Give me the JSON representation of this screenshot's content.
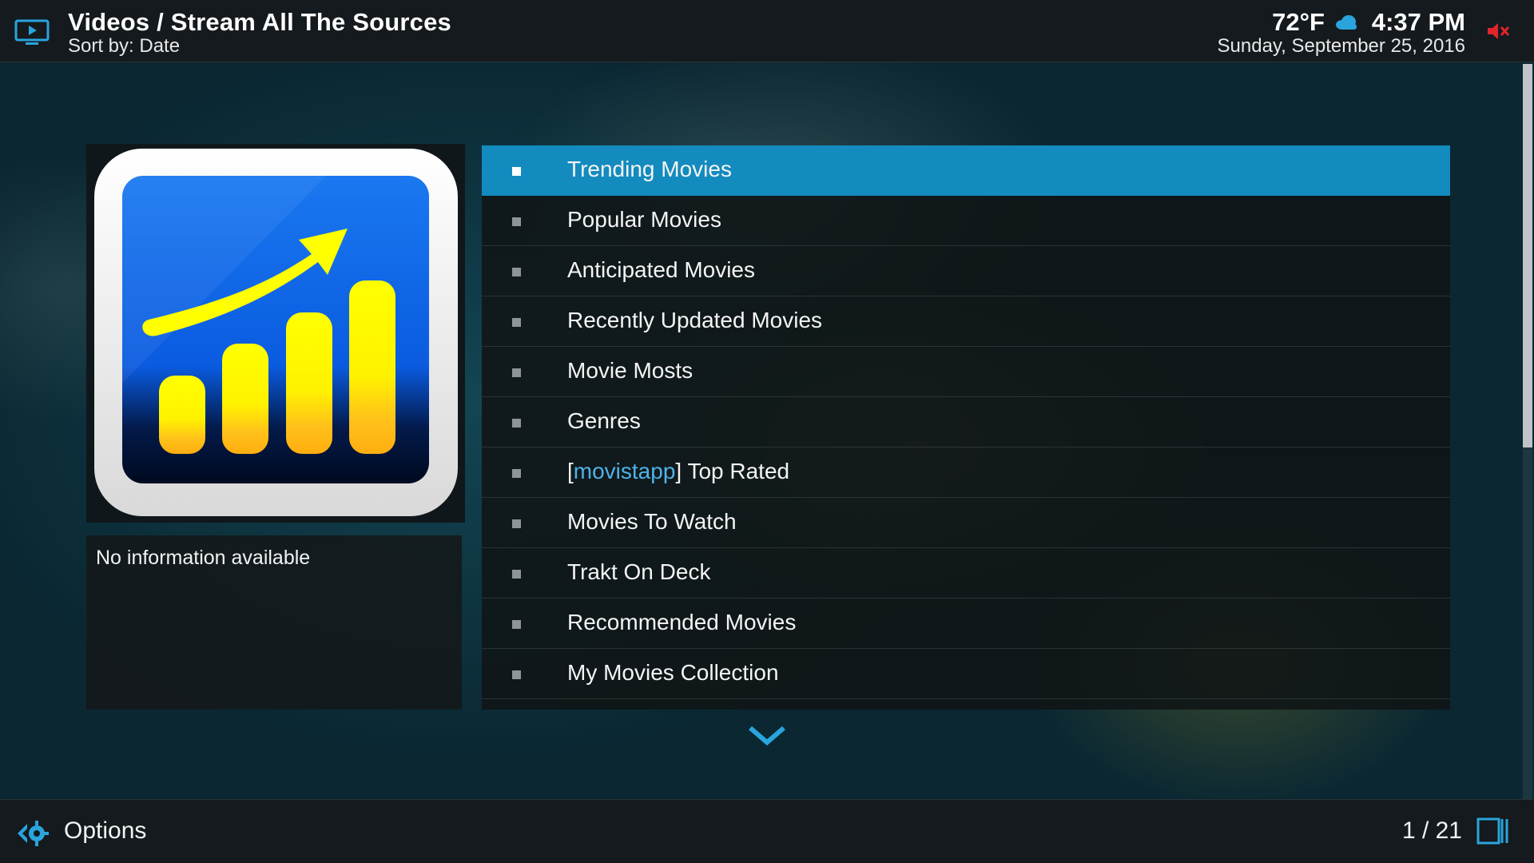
{
  "header": {
    "title": "Videos / Stream All The Sources",
    "sort_label": "Sort by: Date",
    "temperature": "72°F",
    "time": "4:37 PM",
    "date": "Sunday, September 25, 2016"
  },
  "thumbnail": {
    "icon": "trending-chart-icon",
    "colors": {
      "background": "#0a63e6",
      "bars": "#ffee00",
      "frame": "#f0f0f0"
    }
  },
  "info": {
    "text": "No information available"
  },
  "list": {
    "selected_index": 0,
    "items": [
      {
        "label": "Trending Movies"
      },
      {
        "label": "Popular Movies"
      },
      {
        "label": "Anticipated Movies"
      },
      {
        "label": "Recently Updated Movies"
      },
      {
        "label": "Movie Mosts"
      },
      {
        "label": "Genres"
      },
      {
        "label_prefix": "[",
        "label_tag": "movistapp",
        "label_suffix": "] Top Rated"
      },
      {
        "label": "Movies To Watch"
      },
      {
        "label": "Trakt On Deck"
      },
      {
        "label": "Recommended Movies"
      },
      {
        "label": "My Movies Collection"
      }
    ]
  },
  "footer": {
    "options_label": "Options",
    "page_count": "1 / 21"
  },
  "colors": {
    "accent": "#138bbf",
    "bar_background": "#141a1e",
    "mute_red": "#e0242a",
    "tag_blue": "#4fb3e8"
  }
}
